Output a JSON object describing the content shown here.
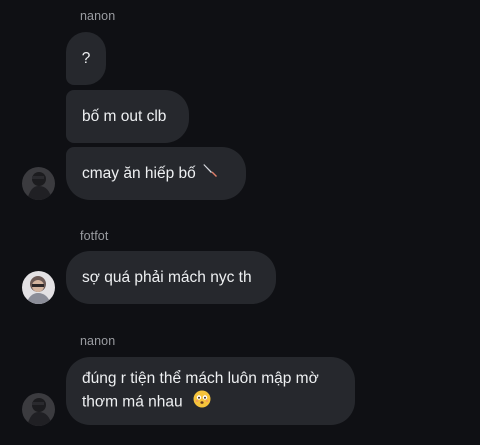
{
  "messages": [
    {
      "sender": "nanon",
      "lines": [
        "?",
        "bố m out clb",
        "cmay ăn hiếp bố"
      ],
      "trailing_icon": "knife-icon"
    },
    {
      "sender": "fotfot",
      "lines": [
        "sợ quá phải mách nyc th"
      ]
    },
    {
      "sender": "nanon",
      "text_line1": "đúng r tiện thể mách luôn mập mờ",
      "text_line2": "thơm má nhau",
      "trailing_icon": "flushed-face-emoji"
    }
  ],
  "colors": {
    "background": "#0f1014",
    "bubble": "#26282d",
    "text": "#eef0f2",
    "sender_name": "#9a9ca1"
  }
}
